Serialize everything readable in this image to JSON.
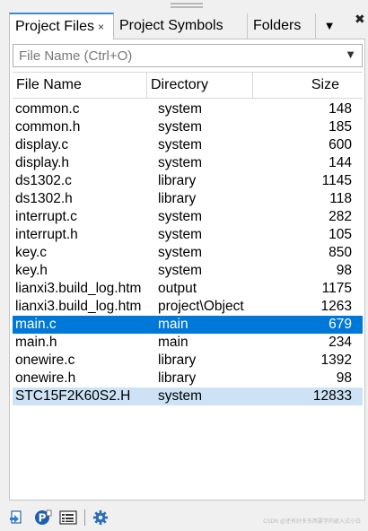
{
  "tabs": [
    {
      "label": "Project Files",
      "close": "×"
    },
    {
      "label": "Project Symbols"
    },
    {
      "label": "Folders"
    }
  ],
  "tabs_more_icon": "chevron-down-icon",
  "search": {
    "placeholder": "File Name (Ctrl+O)"
  },
  "columns": {
    "name": "File Name",
    "directory": "Directory",
    "size": "Size"
  },
  "files": [
    {
      "name": "common.c",
      "dir": "system",
      "size": "148"
    },
    {
      "name": "common.h",
      "dir": "system",
      "size": "185"
    },
    {
      "name": "display.c",
      "dir": "system",
      "size": "600"
    },
    {
      "name": "display.h",
      "dir": "system",
      "size": "144"
    },
    {
      "name": "ds1302.c",
      "dir": "library",
      "size": "1145"
    },
    {
      "name": "ds1302.h",
      "dir": "library",
      "size": "118"
    },
    {
      "name": "interrupt.c",
      "dir": "system",
      "size": "282"
    },
    {
      "name": "interrupt.h",
      "dir": "system",
      "size": "105"
    },
    {
      "name": "key.c",
      "dir": "system",
      "size": "850"
    },
    {
      "name": "key.h",
      "dir": "system",
      "size": "98"
    },
    {
      "name": "lianxi3.build_log.htm",
      "dir": "output",
      "size": "1175"
    },
    {
      "name": "lianxi3.build_log.htm",
      "dir": "project\\Object",
      "size": "1263"
    },
    {
      "name": "main.c",
      "dir": "main",
      "size": "679"
    },
    {
      "name": "main.h",
      "dir": "main",
      "size": "234"
    },
    {
      "name": "onewire.c",
      "dir": "library",
      "size": "1392"
    },
    {
      "name": "onewire.h",
      "dir": "library",
      "size": "98"
    },
    {
      "name": "STC15F2K60S2.H",
      "dir": "system",
      "size": "12833"
    }
  ],
  "selected_row": 12,
  "highlighted_row": 16,
  "colors": {
    "selected": "#0078d7",
    "highlight": "#cde3f5",
    "tab_accent": "#3c8ad6"
  },
  "toolbar_icons": [
    "open-file-icon",
    "project-icon",
    "list-icon",
    "settings-gear-icon"
  ],
  "watermark": "CSDN @还有好多东西要学的嵌入式小白"
}
